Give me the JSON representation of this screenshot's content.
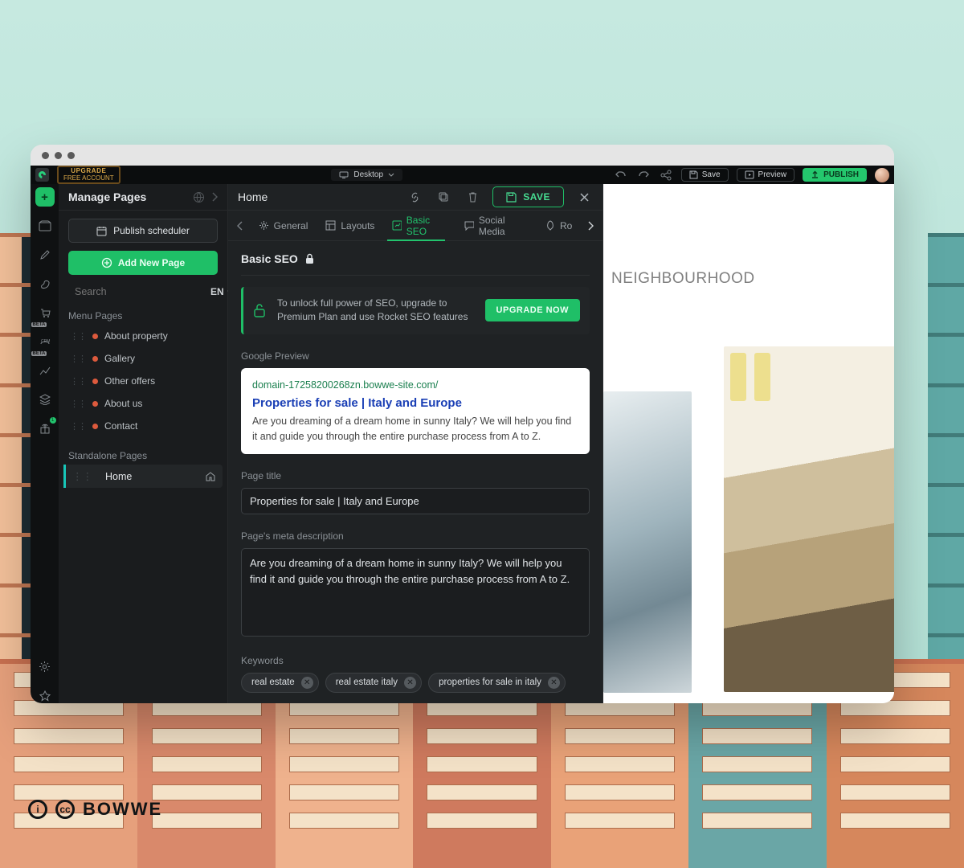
{
  "brand_watermark": "BOWWE",
  "topbar": {
    "upgrade_line1": "UPGRADE",
    "upgrade_line2": "FREE ACCOUNT",
    "viewport": "Desktop",
    "save": "Save",
    "preview": "Preview",
    "publish": "PUBLISH"
  },
  "manage": {
    "title": "Manage Pages",
    "scheduler": "Publish scheduler",
    "add_page": "Add New Page",
    "search_placeholder": "Search",
    "lang": "EN",
    "group_menu": "Menu Pages",
    "group_standalone": "Standalone Pages",
    "menu_items": [
      "About property",
      "Gallery",
      "Other offers",
      "About us",
      "Contact"
    ],
    "standalone_items": [
      "Home"
    ]
  },
  "seo": {
    "page_name": "Home",
    "save": "SAVE",
    "tabs": {
      "general": "General",
      "layouts": "Layouts",
      "basic_seo": "Basic SEO",
      "social": "Social Media",
      "rocket_prefix": "Ro"
    },
    "section_title": "Basic SEO",
    "unlock_text": "To unlock full power of SEO, upgrade to Premium Plan and use Rocket SEO features",
    "upgrade_now": "UPGRADE NOW",
    "google_preview_label": "Google Preview",
    "preview": {
      "url": "domain-17258200268zn.bowwe-site.com/",
      "title": "Properties for sale | Italy and Europe",
      "desc": "Are you dreaming of a dream home in sunny Italy? We will help you find it and guide you through the entire purchase process from A to Z."
    },
    "page_title_label": "Page title",
    "page_title_value": "Properties for sale | Italy and Europe",
    "meta_desc_label": "Page's meta description",
    "meta_desc_value": "Are you dreaming of a dream home in sunny Italy? We will help you find it and guide you through the entire purchase process from A to Z.",
    "keywords_label": "Keywords",
    "keywords": [
      "real estate",
      "real estate italy",
      "properties for sale in italy"
    ]
  },
  "canvas": {
    "neighbourhood": "NEIGHBOURHOOD"
  }
}
